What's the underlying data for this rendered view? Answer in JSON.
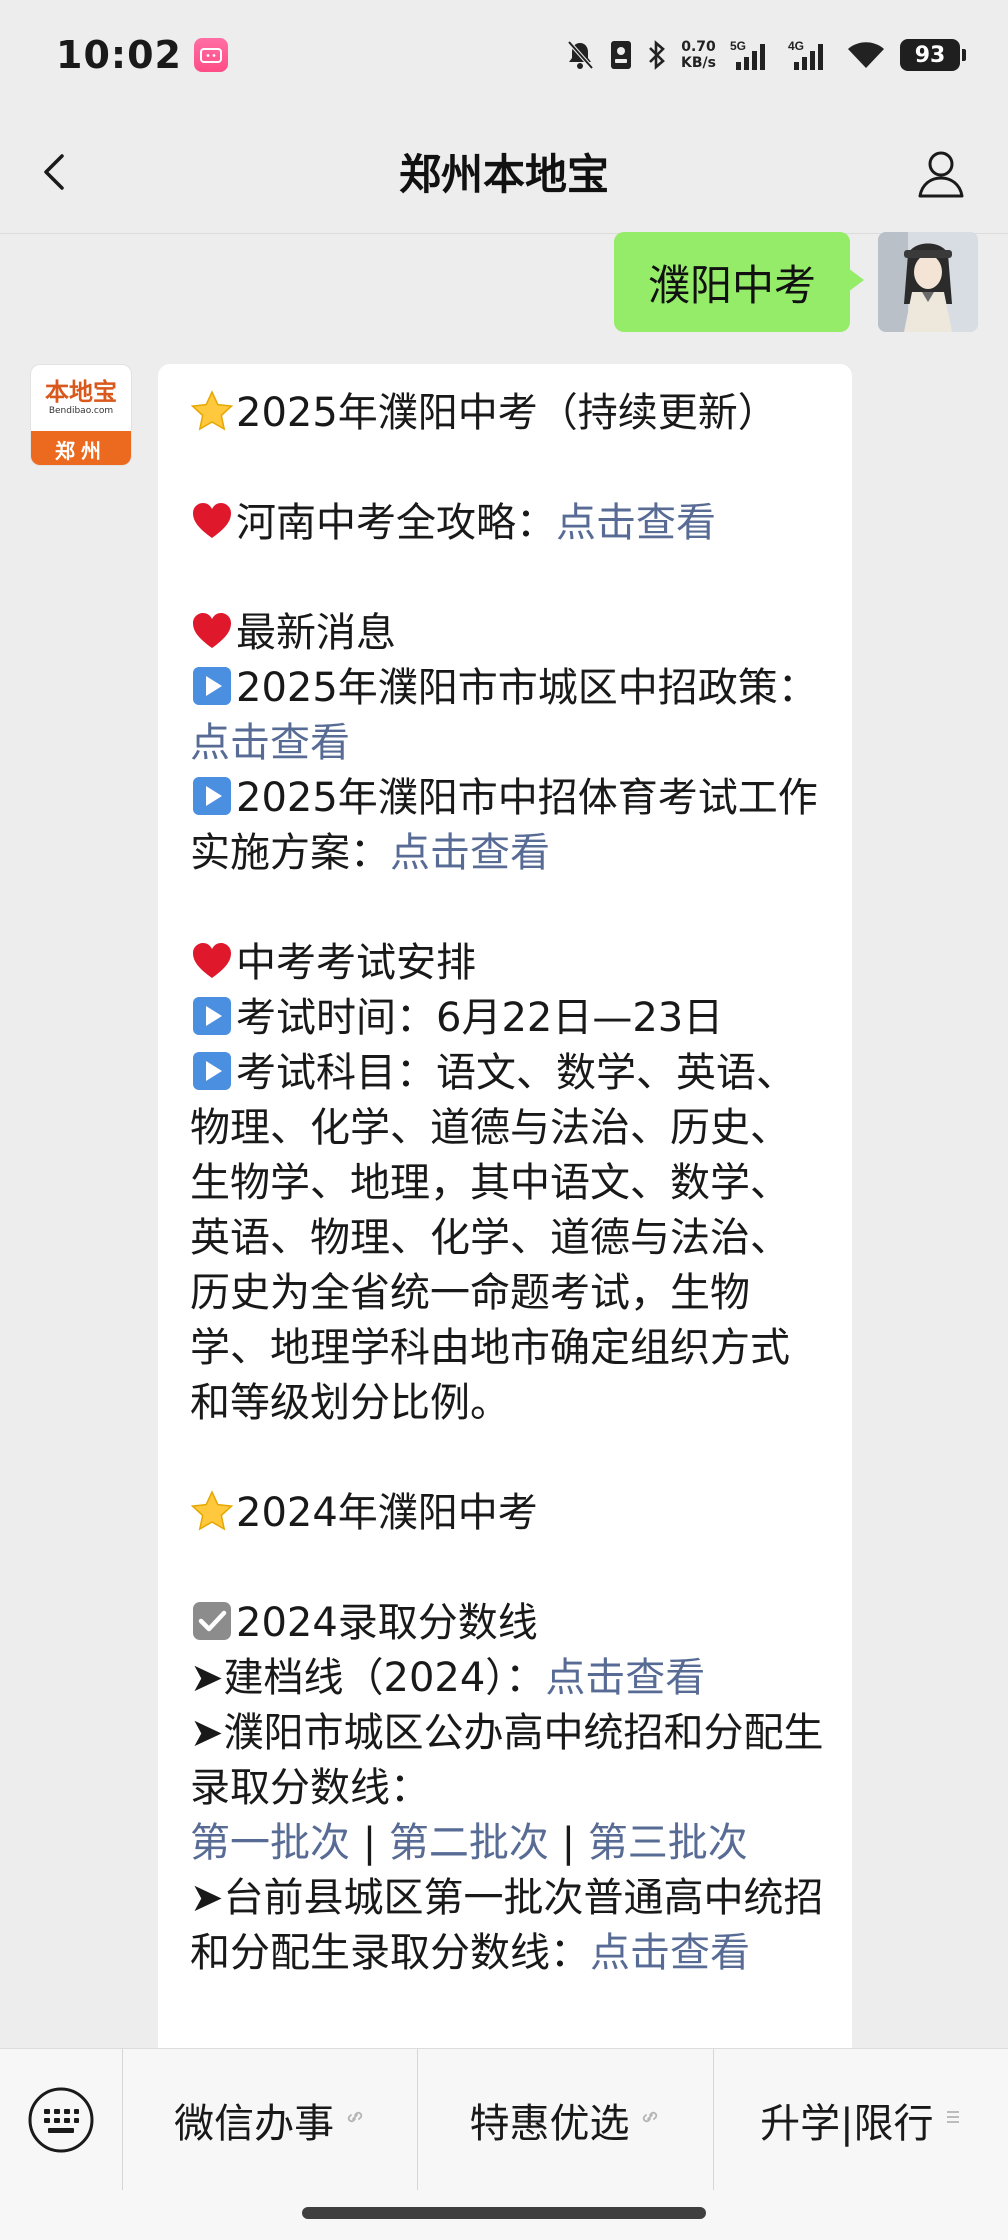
{
  "status_bar": {
    "time": "10:02",
    "app_badge": "bilibili",
    "speed_value": "0.70",
    "speed_unit": "KB/s",
    "net1": "5G",
    "net2": "4G",
    "battery": "93"
  },
  "nav": {
    "title": "郑州本地宝"
  },
  "sent_message": "濮阳中考",
  "brand_avatar": {
    "name": "本地宝",
    "url": "Bendibao.com",
    "city": "郑州"
  },
  "received_message": {
    "title": "2025年濮阳中考（持续更新）",
    "strategy_label": "河南中考全攻略：",
    "strategy_link": "点击查看",
    "news_heading": "最新消息",
    "news1_text": "2025年濮阳市市城区中招政策：",
    "news1_link": "点击查看",
    "news2_text": "2025年濮阳市中招体育考试工作实施方案：",
    "news2_link": "点击查看",
    "schedule_heading": "中考考试安排",
    "exam_time": "考试时间：6月22日—23日",
    "exam_subjects": "考试科目：语文、数学、英语、物理、化学、道德与法治、历史、生物学、地理，其中语文、数学、英语、物理、化学、道德与法治、历史为全省统一命题考试，生物学、地理学科由地市确定组织方式和等级划分比例。",
    "title_2024": "2024年濮阳中考",
    "score_heading": "2024录取分数线",
    "filing_line_text": "➤建档线（2024）：",
    "filing_line_link": "点击查看",
    "city_line_text": "➤濮阳市城区公办高中统招和分配生录取分数线：",
    "batch1": "第一批次",
    "batch2": "第二批次",
    "batch3": "第三批次",
    "separator": " | ",
    "taiqian_text": "➤台前县城区第一批次普通高中统招和分配生录取分数线：",
    "taiqian_link": "点击查看"
  },
  "bottom_menu": {
    "items": [
      "微信办事",
      "特惠优选",
      "升学|限行"
    ]
  },
  "colors": {
    "sent_bubble": "#95ec69",
    "link": "#576b95",
    "background": "#ededed"
  }
}
